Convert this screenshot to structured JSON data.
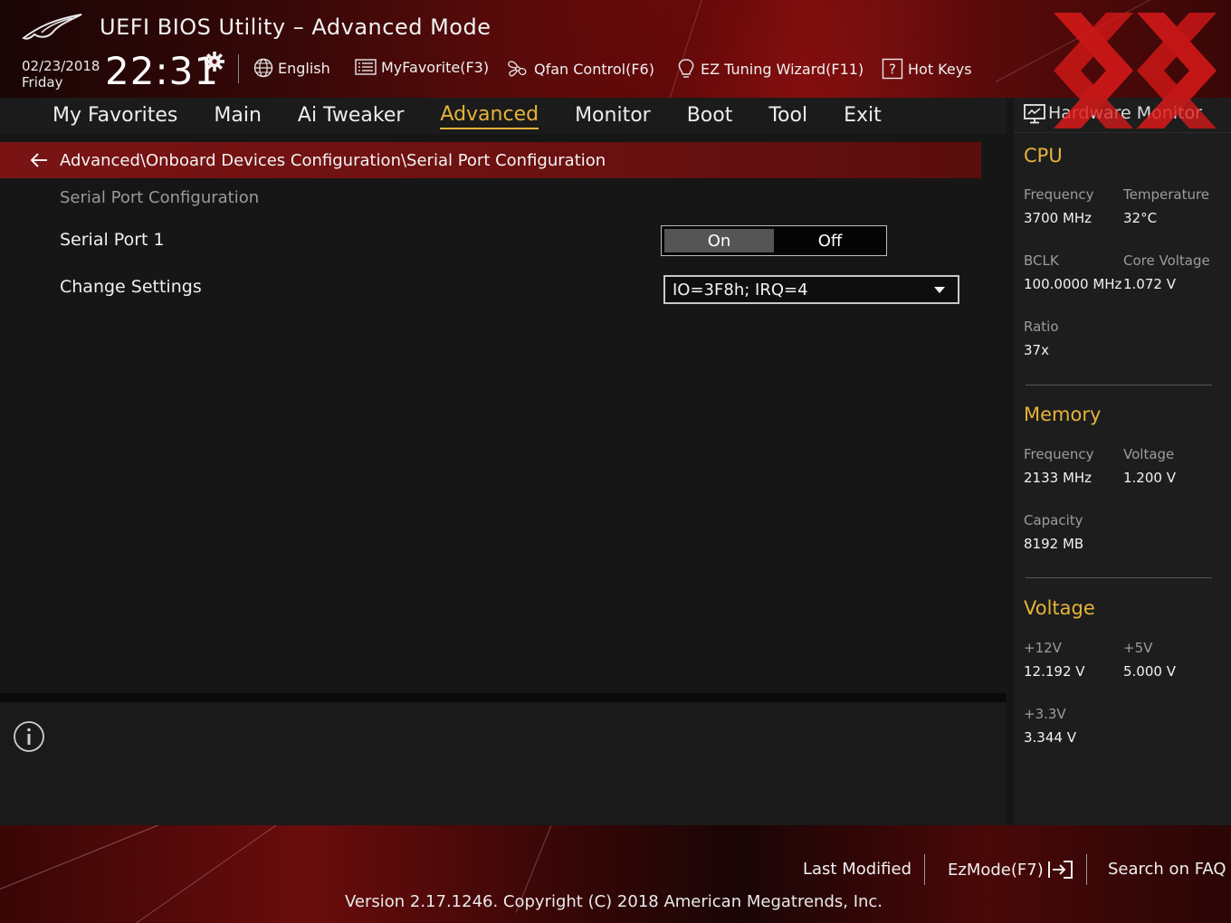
{
  "header": {
    "title": "UEFI BIOS Utility – Advanced Mode",
    "date": "02/23/2018",
    "day": "Friday",
    "time": "22:31",
    "items": [
      {
        "label": "English",
        "icon": "globe-icon"
      },
      {
        "label": "MyFavorite(F3)",
        "icon": "list-icon"
      },
      {
        "label": "Qfan Control(F6)",
        "icon": "fan-icon"
      },
      {
        "label": "EZ Tuning Wizard(F11)",
        "icon": "lightbulb-icon"
      },
      {
        "label": "Hot Keys",
        "icon": "question-icon"
      }
    ]
  },
  "nav": {
    "tabs": [
      "My Favorites",
      "Main",
      "Ai Tweaker",
      "Advanced",
      "Monitor",
      "Boot",
      "Tool",
      "Exit"
    ],
    "active": "Advanced"
  },
  "breadcrumb": "Advanced\\Onboard Devices Configuration\\Serial Port Configuration",
  "main": {
    "section_label": "Serial Port Configuration",
    "serial_port": {
      "label": "Serial Port 1",
      "on_label": "On",
      "off_label": "Off",
      "selected": "On"
    },
    "change_settings": {
      "label": "Change Settings",
      "value": "IO=3F8h; IRQ=4"
    }
  },
  "hw_monitor": {
    "title": "Hardware Monitor",
    "cpu": {
      "heading": "CPU",
      "frequency_label": "Frequency",
      "frequency": "3700 MHz",
      "temperature_label": "Temperature",
      "temperature": "32°C",
      "bclk_label": "BCLK",
      "bclk": "100.0000 MHz",
      "core_voltage_label": "Core Voltage",
      "core_voltage": "1.072 V",
      "ratio_label": "Ratio",
      "ratio": "37x"
    },
    "memory": {
      "heading": "Memory",
      "frequency_label": "Frequency",
      "frequency": "2133 MHz",
      "voltage_label": "Voltage",
      "voltage": "1.200 V",
      "capacity_label": "Capacity",
      "capacity": "8192 MB"
    },
    "voltage": {
      "heading": "Voltage",
      "v12_label": "+12V",
      "v12": "12.192 V",
      "v5_label": "+5V",
      "v5": "5.000 V",
      "v33_label": "+3.3V",
      "v33": "3.344 V"
    }
  },
  "footer": {
    "last_modified": "Last Modified",
    "ezmode": "EzMode(F7)",
    "search_faq": "Search on FAQ",
    "version": "Version 2.17.1246. Copyright (C) 2018 American Megatrends, Inc."
  },
  "colors": {
    "accent": "#e6b33a",
    "breadcrumb_bg": "#7a1414",
    "watermark": "#e01a1a"
  }
}
